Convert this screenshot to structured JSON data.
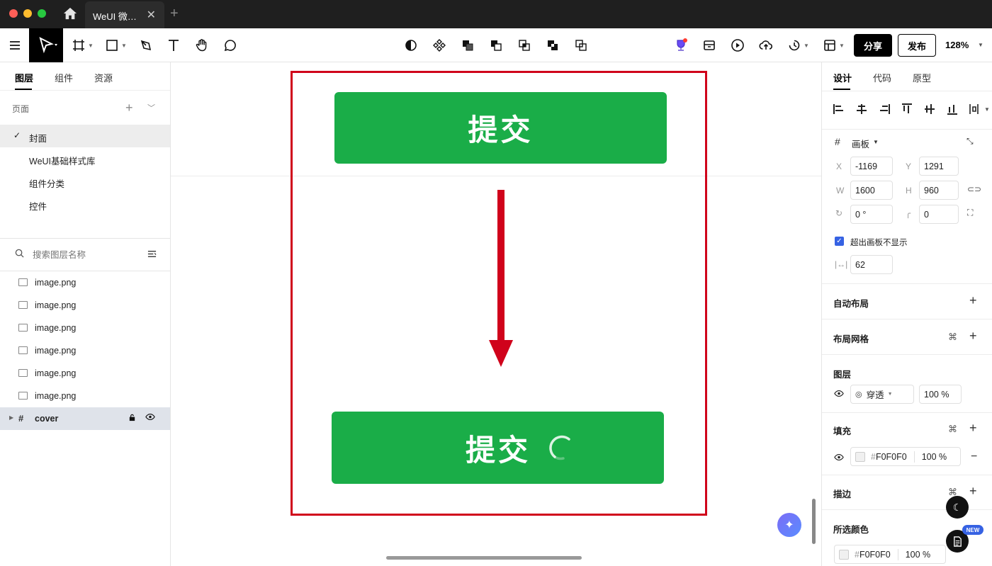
{
  "window": {
    "tab_title": "WeUI 微…",
    "tab_close": "✕",
    "new_tab": "+"
  },
  "toolbar": {
    "share_label": "分享",
    "publish_label": "发布",
    "zoom": "128%"
  },
  "left_panel": {
    "tabs": [
      "图层",
      "组件",
      "资源"
    ],
    "pages_header": "页面",
    "pages": [
      {
        "label": "封面",
        "selected": true
      },
      {
        "label": "WeUI基础样式库",
        "selected": false
      },
      {
        "label": "组件分类",
        "selected": false
      },
      {
        "label": "控件",
        "selected": false
      }
    ],
    "search_placeholder": "搜索图层名称",
    "layers": [
      "image.png",
      "image.png",
      "image.png",
      "image.png",
      "image.png",
      "image.png"
    ],
    "frame_layer": "cover"
  },
  "canvas": {
    "top_button_label": "提交",
    "bottom_button_label": "提交",
    "colors": {
      "button": "#1aad48",
      "frame": "#d0021b"
    }
  },
  "right_panel": {
    "tabs": [
      "设计",
      "代码",
      "原型"
    ],
    "frame_type": "画板",
    "x_label": "X",
    "x_value": "-1169",
    "y_label": "Y",
    "y_value": "1291",
    "w_label": "W",
    "w_value": "1600",
    "h_label": "H",
    "h_value": "960",
    "rotation_value": "0 °",
    "radius_value": "0",
    "clip_label": "超出画板不显示",
    "spacing_value": "62",
    "auto_layout": "自动布局",
    "layout_grid": "布局网格",
    "layer_section": "图层",
    "blend_mode": "穿透",
    "layer_opacity": "100 %",
    "fill_section": "填充",
    "fill_hex": "F0F0F0",
    "fill_opacity": "100 %",
    "stroke_section": "描边",
    "selected_colors": "所选颜色",
    "sel_hex": "F0F0F0",
    "sel_opacity": "100 %",
    "new_badge": "NEW"
  }
}
